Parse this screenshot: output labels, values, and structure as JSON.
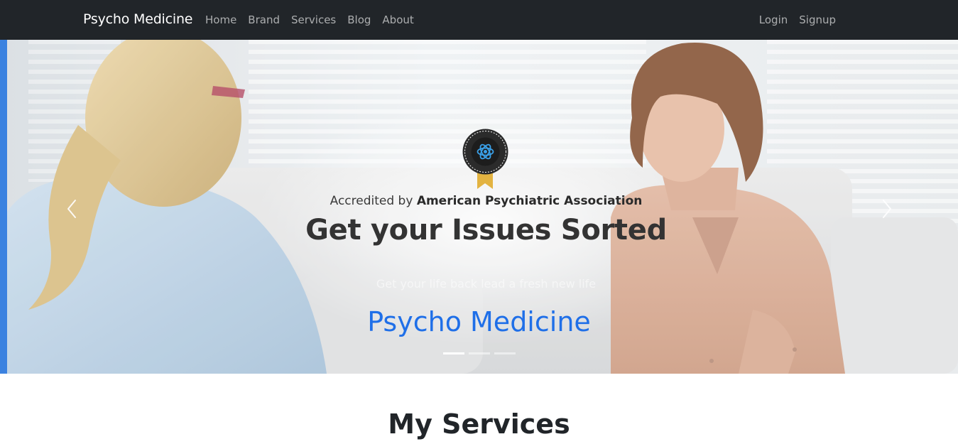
{
  "navbar": {
    "brand": "Psycho Medicine",
    "left_links": [
      "Home",
      "Brand",
      "Services",
      "Blog",
      "About"
    ],
    "right_links": [
      "Login",
      "Signup"
    ]
  },
  "carousel": {
    "accredited_prefix": "Accredited by ",
    "accredited_org": "American Psychiatric Association",
    "headline": "Get your Issues Sorted",
    "subtext": "Get your life back lead a fresh new life",
    "caption_title": "Psycho Medicine",
    "prev_icon": "chevron-left-icon",
    "next_icon": "chevron-right-icon",
    "active_slide": 1,
    "slide_count": 3
  },
  "services": {
    "title": "My Services"
  },
  "colors": {
    "navbar_bg": "#212529",
    "caption_blue": "#1f6fe8",
    "accent_bar": "#3b82e0"
  }
}
